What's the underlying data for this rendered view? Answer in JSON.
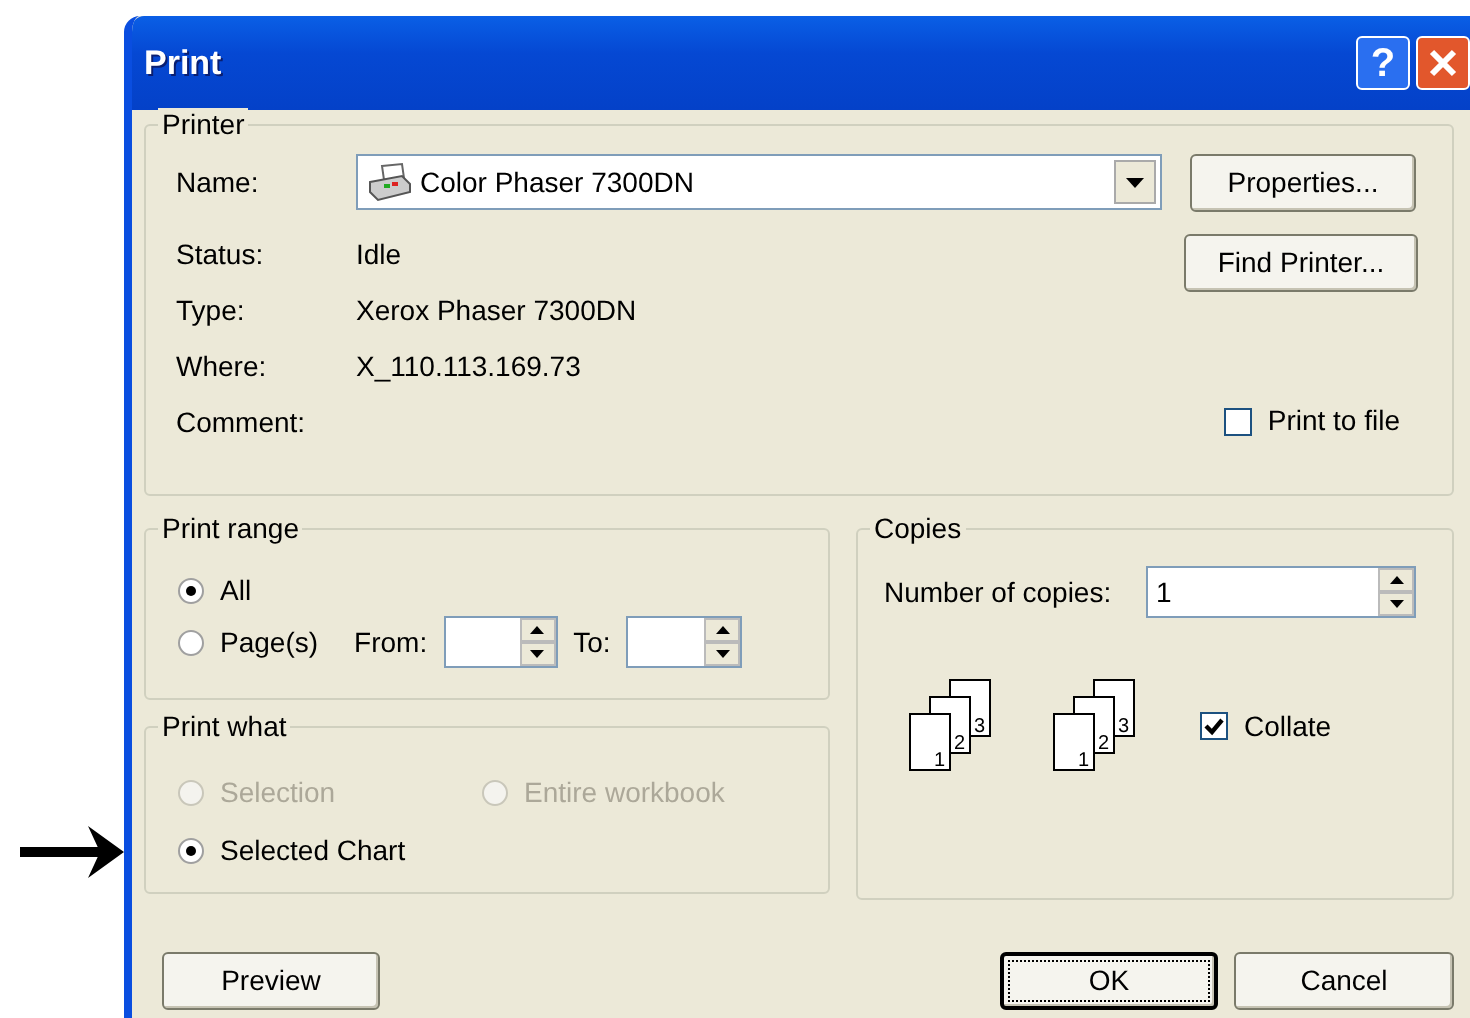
{
  "window": {
    "title": "Print",
    "help_button": "?"
  },
  "printer": {
    "legend": "Printer",
    "name_label": "Name:",
    "name_value": "Color Phaser 7300DN",
    "fields": [
      {
        "label": "Status:",
        "value": "Idle"
      },
      {
        "label": "Type:",
        "value": "Xerox Phaser 7300DN"
      },
      {
        "label": "Where:",
        "value": "X_110.113.169.73"
      },
      {
        "label": "Comment:"
      }
    ],
    "buttons": [
      "Properties...",
      "Find Printer..."
    ],
    "print_to_file": {
      "label": "Print to file",
      "checked": false
    }
  },
  "print_range": {
    "legend": "Print range",
    "options": [
      {
        "label": "All",
        "selected": true
      },
      {
        "label": "Page(s)",
        "selected": false
      }
    ],
    "from_label": "From:",
    "to_label": "To:"
  },
  "print_what": {
    "legend": "Print what",
    "options": [
      {
        "label": "Selection",
        "selected": false,
        "disabled": true
      },
      {
        "label": "Entire workbook",
        "selected": false,
        "disabled": true
      },
      {
        "label": "Selected Chart",
        "selected": true,
        "disabled": false
      }
    ]
  },
  "copies": {
    "legend": "Copies",
    "number_label": "Number of copies:",
    "number_value": "1",
    "page_stacks": [
      {
        "pages": [
          "1",
          "2",
          "3"
        ]
      },
      {
        "pages": [
          "1",
          "2",
          "3"
        ]
      }
    ],
    "collate": {
      "label": "Collate",
      "checked": true
    }
  },
  "buttons": [
    {
      "label": "Preview",
      "focused": false
    },
    {
      "label": "OK",
      "focused": true
    },
    {
      "label": "Cancel",
      "focused": false
    }
  ]
}
